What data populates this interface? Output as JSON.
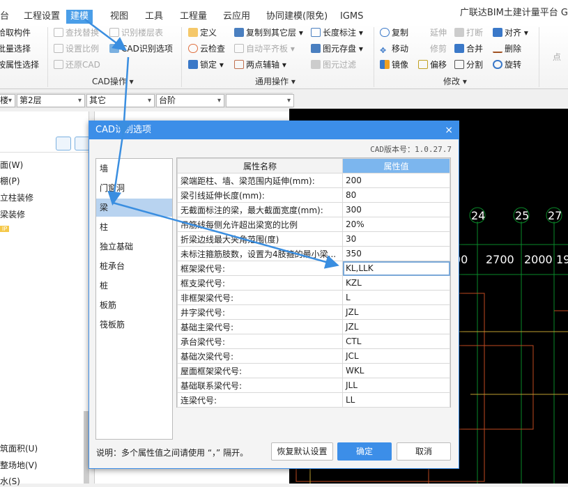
{
  "app_title": "广联达BIM土建计量平台 G",
  "tabs": [
    "台",
    "工程设置",
    "建模",
    "视图",
    "工具",
    "工程量",
    "云应用",
    "协同建模(限免)",
    "IGMS"
  ],
  "active_tab": "建模",
  "ribbon": {
    "left_items": [
      "拾取构件",
      "批量选择",
      "按属性选择"
    ],
    "cad_ops": {
      "items": [
        "查找替换",
        "识别楼层表",
        "设置比例",
        "CAD识别选项",
        "还原CAD"
      ],
      "label": "CAD操作"
    },
    "general_ops": {
      "items": [
        "定义",
        "复制到其它层",
        "长度标注",
        "云检查",
        "自动平齐板",
        "图元存盘",
        "锁定",
        "两点辅轴",
        "图元过滤"
      ],
      "label": "通用操作"
    },
    "modify": {
      "items": [
        "复制",
        "延伸",
        "打断",
        "对齐",
        "移动",
        "修剪",
        "合并",
        "删除",
        "镜像",
        "偏移",
        "分割",
        "旋转"
      ],
      "label": "修改"
    },
    "point_label": "点"
  },
  "combos": [
    "楼",
    "第2层",
    "其它",
    "台阶",
    ""
  ],
  "left_panel": {
    "items": [
      "面(W)",
      "棚(P)",
      "立柱装修",
      "梁装修"
    ],
    "badge": "IP",
    "bottom_items": [
      "筑面积(U)",
      "整场地(V)",
      "水(S)"
    ]
  },
  "cad_view": {
    "axis_labels": [
      "24",
      "25",
      "27"
    ],
    "dimensions": [
      "00",
      "2700",
      "2000",
      "19"
    ]
  },
  "dialog": {
    "title": "CAD识别选项",
    "version": "CAD版本号：1.0.27.7",
    "categories": [
      "墙",
      "门窗洞",
      "梁",
      "柱",
      "独立基础",
      "桩承台",
      "桩",
      "板筋",
      "筏板筋"
    ],
    "selected_category": "梁",
    "columns": [
      "属性名称",
      "属性值"
    ],
    "rows": [
      [
        "梁端距柱、墙、梁范围内延伸(mm):",
        "200"
      ],
      [
        "梁引线延伸长度(mm):",
        "80"
      ],
      [
        "无截面标注的梁，最大截面宽度(mm):",
        "300"
      ],
      [
        "吊筋线每侧允许超出梁宽的比例",
        "20%"
      ],
      [
        "折梁边线最大夹角范围(度)",
        "30"
      ],
      [
        "未标注箍筋肢数，设置为4肢箍的最小梁...",
        "350"
      ],
      [
        "框架梁代号:",
        "KL,LLK"
      ],
      [
        "框支梁代号:",
        "KZL"
      ],
      [
        "非框架梁代号:",
        "L"
      ],
      [
        "井字梁代号:",
        "JZL"
      ],
      [
        "基础主梁代号:",
        "JZL"
      ],
      [
        "承台梁代号:",
        "CTL"
      ],
      [
        "基础次梁代号:",
        "JCL"
      ],
      [
        "屋面框架梁代号:",
        "WKL"
      ],
      [
        "基础联系梁代号:",
        "JLL"
      ],
      [
        "连梁代号:",
        "LL"
      ]
    ],
    "note": "说明：多个属性值之间请使用 “，” 隔开。",
    "buttons": {
      "restore": "恢复默认设置",
      "ok": "确定",
      "cancel": "取消"
    },
    "close": "×"
  },
  "colors": {
    "accent": "#3c8ee8",
    "header_value": "#7cb6ee",
    "selection": "#b8d3f0"
  }
}
